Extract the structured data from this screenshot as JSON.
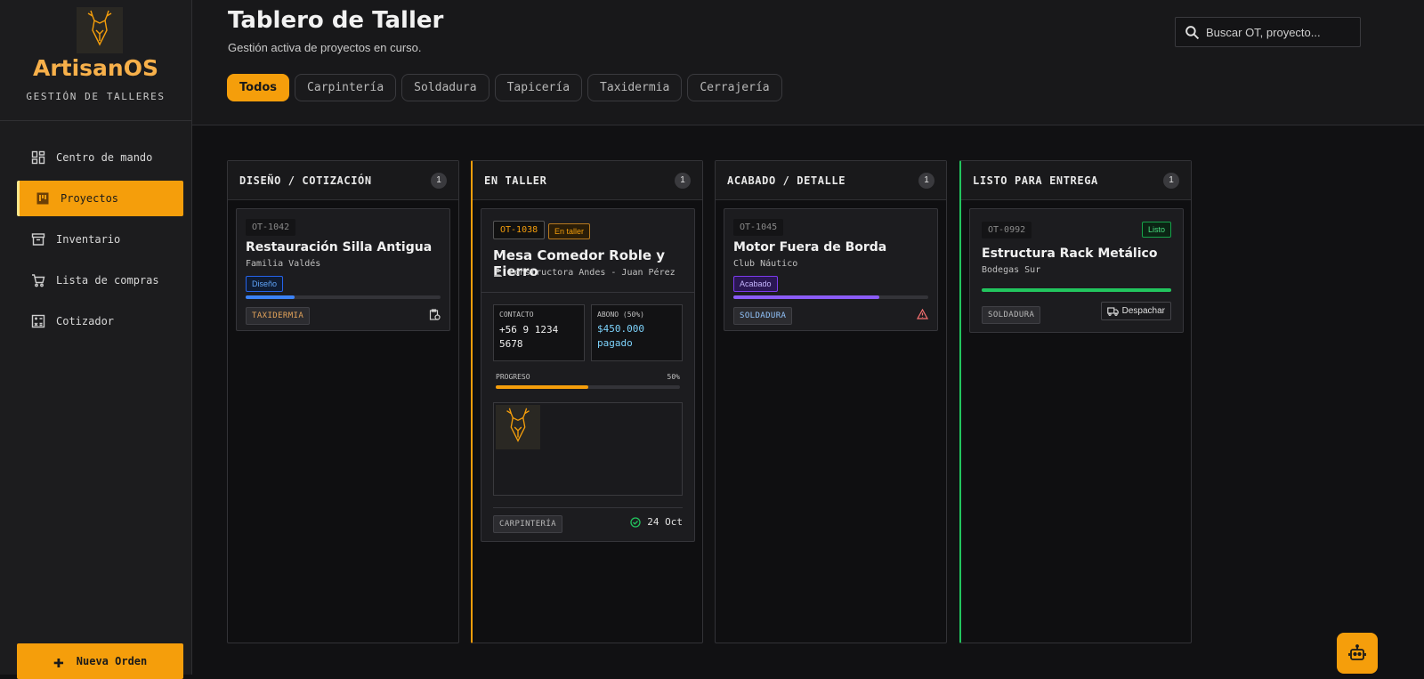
{
  "brand": {
    "title": "ArtisanOS",
    "subtitle": "GESTIÓN DE TALLERES",
    "logo": "deer-logo-icon"
  },
  "nav": [
    {
      "label": "Centro de mando",
      "icon": "dashboard-icon"
    },
    {
      "label": "Proyectos",
      "icon": "kanban-icon",
      "active": true
    },
    {
      "label": "Inventario",
      "icon": "archive-icon"
    },
    {
      "label": "Lista de compras",
      "icon": "cart-icon"
    },
    {
      "label": "Cotizador",
      "icon": "calculator-icon"
    }
  ],
  "new_order": {
    "label": "Nueva Orden",
    "icon": "plus-icon"
  },
  "header": {
    "title": "Tablero de Taller",
    "subtitle": "Gestión activa de proyectos en curso.",
    "search_placeholder": "Buscar OT, proyecto..."
  },
  "filters": [
    "Todos",
    "Carpintería",
    "Soldadura",
    "Tapicería",
    "Taxidermia",
    "Cerrajería"
  ],
  "active_filter": "Todos",
  "columns": [
    {
      "title": "DISEÑO / COTIZACIÓN",
      "count": "1",
      "card": {
        "ot": "OT-1042",
        "title": "Restauración Silla Antigua",
        "client": "Familia Valdés",
        "status": "Diseño",
        "progress": 0.25,
        "category": "TAXIDERMIA",
        "icon": "clipboard-clock-icon"
      }
    },
    {
      "title": "EN TALLER",
      "count": "1",
      "card": {
        "ot": "OT-1038",
        "status": "En taller",
        "title": "Mesa Comedor Roble y Fierro",
        "client": "Constructora Andes - Juan Pérez",
        "contact_label": "CONTACTO",
        "contact_value": "+56 9 1234 5678",
        "deposit_label": "ABONO (50%)",
        "deposit_value": "$450.000",
        "deposit_note": "pagado",
        "progress_label": "PROGRESO",
        "progress_text": "50%",
        "progress": 0.5,
        "category": "CARPINTERÍA",
        "date": "24 Oct"
      }
    },
    {
      "title": "ACABADO / DETALLE",
      "count": "1",
      "card": {
        "ot": "OT-1045",
        "title": "Motor Fuera de Borda",
        "client": "Club Náutico",
        "status": "Acabado",
        "progress": 0.75,
        "category": "SOLDADURA",
        "icon": "warning-icon"
      }
    },
    {
      "title": "LISTO PARA ENTREGA",
      "count": "1",
      "card": {
        "ot": "OT-0992",
        "status": "Listo",
        "title": "Estructura Rack Metálico",
        "client": "Bodegas Sur",
        "progress": 1.0,
        "category": "SOLDADURA",
        "action": "Despachar"
      }
    }
  ],
  "colors": {
    "accent": "#f59e0b",
    "blue": "#3b82f6",
    "purple": "#8b5cf6",
    "green": "#22c55e"
  }
}
